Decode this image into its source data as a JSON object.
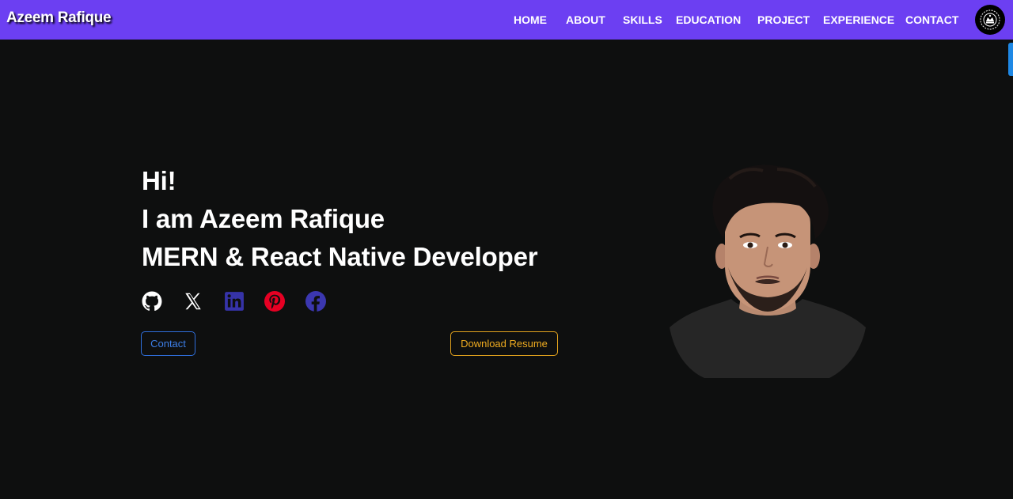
{
  "navbar": {
    "brand": "Azeem Rafique",
    "background": "#6c3ff2",
    "links": [
      "HOME",
      "ABOUT",
      "SKILLS",
      "EDUCATION",
      "PROJECT",
      "EXPERIENCE",
      "CONTACT"
    ]
  },
  "hero": {
    "greeting": "Hi!",
    "intro": "I am Azeem Rafique",
    "role": "MERN & React Native Developer",
    "socials": [
      {
        "icon": "github-icon",
        "color": "#ffffff"
      },
      {
        "icon": "x-twitter-icon",
        "color": "#ffffff"
      },
      {
        "icon": "linkedin-icon",
        "color": "#3633a8"
      },
      {
        "icon": "pinterest-icon",
        "color": "#e60023"
      },
      {
        "icon": "facebook-icon",
        "color": "#3b37b0"
      }
    ],
    "buttons": {
      "contact": "Contact",
      "resume": "Download Resume"
    }
  },
  "colors": {
    "page_bg": "#0e0f0f",
    "contact_accent": "#2f6fdc",
    "resume_accent": "#e2a21d"
  }
}
